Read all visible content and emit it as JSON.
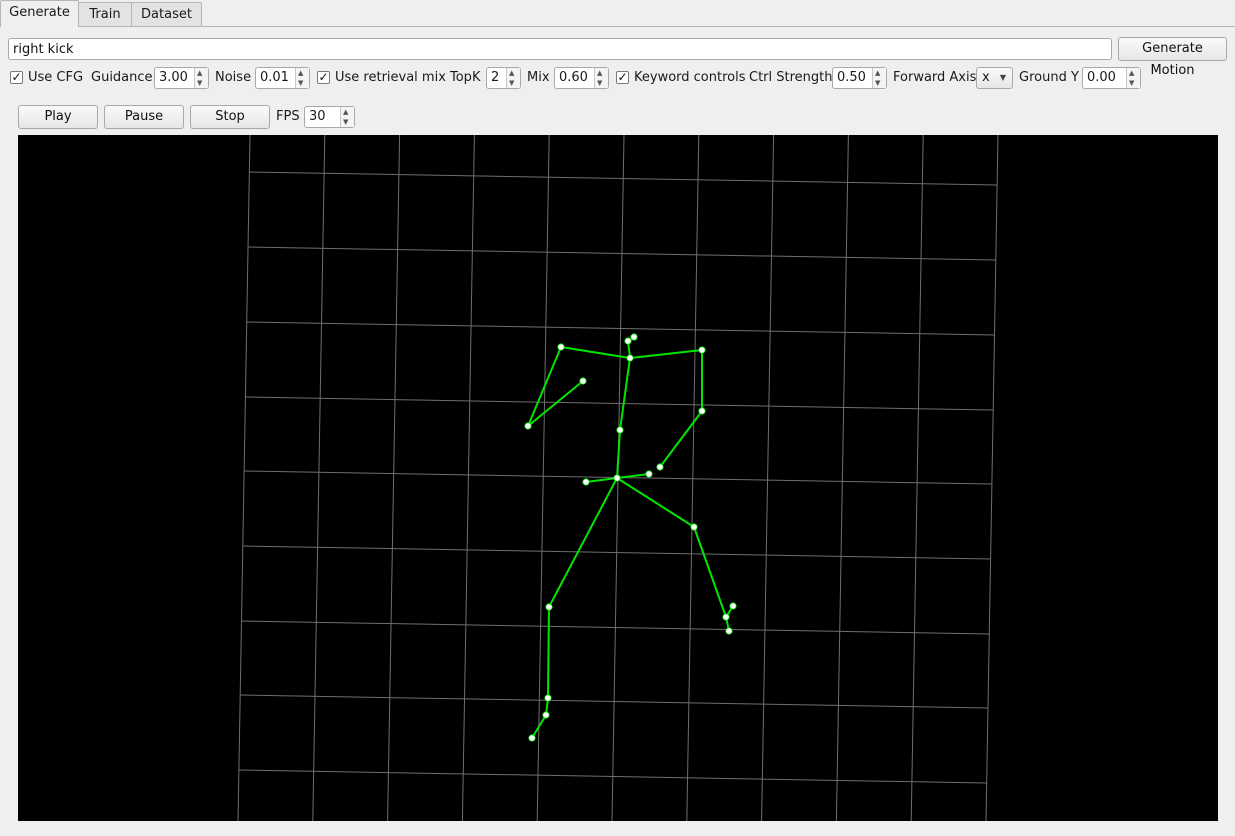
{
  "tabs": [
    {
      "label": "Generate",
      "active": true
    },
    {
      "label": "Train",
      "active": false
    },
    {
      "label": "Dataset",
      "active": false
    }
  ],
  "prompt": {
    "value": "right kick"
  },
  "generate_button": "Generate Motion",
  "controls": {
    "use_cfg": {
      "label": "Use CFG",
      "checked": true
    },
    "guidance": {
      "label": "Guidance",
      "value": "3.00"
    },
    "noise": {
      "label": "Noise",
      "value": "0.01"
    },
    "use_retrieval_mix": {
      "label": "Use retrieval mix",
      "checked": true
    },
    "topk": {
      "label": "TopK",
      "value": "2"
    },
    "mix": {
      "label": "Mix",
      "value": "0.60"
    },
    "keyword_controls": {
      "label": "Keyword controls",
      "checked": true
    },
    "ctrl_strength": {
      "label": "Ctrl Strength",
      "value": "0.50"
    },
    "forward_axis": {
      "label": "Forward Axis",
      "value": "x"
    },
    "ground_y": {
      "label": "Ground Y",
      "value": "0.00"
    }
  },
  "playback": {
    "play": "Play",
    "pause": "Pause",
    "stop": "Stop",
    "fps_label": "FPS",
    "fps_value": "30"
  },
  "colors": {
    "skeleton": "#00e600",
    "grid": "#6e6e6e",
    "viewport_bg": "#000000",
    "joint": "#ffffff"
  },
  "check_glyph": "✓",
  "spin_up": "▲",
  "spin_down": "▼",
  "combo_caret": "▼"
}
